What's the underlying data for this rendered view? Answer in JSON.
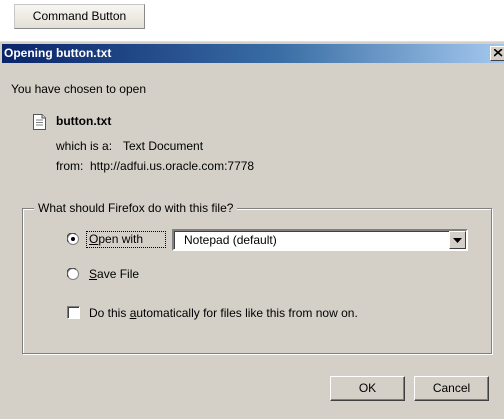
{
  "page": {
    "command_button_label": "Command Button"
  },
  "dialog": {
    "title": "Opening button.txt",
    "intro": "You have chosen to open",
    "file_name": "button.txt",
    "which_is_label": "which is a:",
    "file_type": "Text Document",
    "from_label": "from:",
    "from_url": "http://adfui.us.oracle.com:7778",
    "question": "What should Firefox do with this file?",
    "open_with": {
      "label": "Open with",
      "selected": true,
      "app": "Notepad (default)"
    },
    "save_file": {
      "label": "Save File",
      "selected": false
    },
    "auto_checkbox": {
      "label": "Do this automatically for files like this from now on.",
      "checked": false
    },
    "ok_label": "OK",
    "cancel_label": "Cancel"
  },
  "colors": {
    "dialog_bg": "#d4d0c8",
    "title_start": "#0a246a",
    "title_end": "#a6caf0"
  },
  "icons": {
    "file": "text-file-icon",
    "close": "close-icon",
    "dropdown": "chevron-down-icon"
  }
}
